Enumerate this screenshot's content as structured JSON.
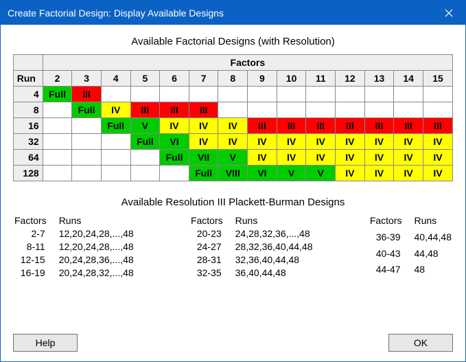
{
  "window": {
    "title": "Create Factorial Design: Display Available Designs"
  },
  "captions": {
    "designs": "Available Factorial Designs (with Resolution)",
    "plackett": "Available Resolution III Plackett-Burman Designs"
  },
  "table": {
    "factorsHeader": "Factors",
    "runHeader": "Run",
    "factorCols": [
      "2",
      "3",
      "4",
      "5",
      "6",
      "7",
      "8",
      "9",
      "10",
      "11",
      "12",
      "13",
      "14",
      "15"
    ],
    "rows": [
      {
        "run": "4",
        "cells": [
          {
            "v": "Full",
            "c": "green"
          },
          {
            "v": "III",
            "c": "red"
          },
          null,
          null,
          null,
          null,
          null,
          null,
          null,
          null,
          null,
          null,
          null,
          null
        ]
      },
      {
        "run": "8",
        "cells": [
          null,
          {
            "v": "Full",
            "c": "green"
          },
          {
            "v": "IV",
            "c": "yellow"
          },
          {
            "v": "III",
            "c": "red"
          },
          {
            "v": "III",
            "c": "red"
          },
          {
            "v": "III",
            "c": "red"
          },
          null,
          null,
          null,
          null,
          null,
          null,
          null,
          null
        ]
      },
      {
        "run": "16",
        "cells": [
          null,
          null,
          {
            "v": "Full",
            "c": "green"
          },
          {
            "v": "V",
            "c": "green"
          },
          {
            "v": "IV",
            "c": "yellow"
          },
          {
            "v": "IV",
            "c": "yellow"
          },
          {
            "v": "IV",
            "c": "yellow"
          },
          {
            "v": "III",
            "c": "red"
          },
          {
            "v": "III",
            "c": "red"
          },
          {
            "v": "III",
            "c": "red"
          },
          {
            "v": "III",
            "c": "red"
          },
          {
            "v": "III",
            "c": "red"
          },
          {
            "v": "III",
            "c": "red"
          },
          {
            "v": "III",
            "c": "red"
          }
        ]
      },
      {
        "run": "32",
        "cells": [
          null,
          null,
          null,
          {
            "v": "Full",
            "c": "green"
          },
          {
            "v": "VI",
            "c": "green"
          },
          {
            "v": "IV",
            "c": "yellow"
          },
          {
            "v": "IV",
            "c": "yellow"
          },
          {
            "v": "IV",
            "c": "yellow"
          },
          {
            "v": "IV",
            "c": "yellow"
          },
          {
            "v": "IV",
            "c": "yellow"
          },
          {
            "v": "IV",
            "c": "yellow"
          },
          {
            "v": "IV",
            "c": "yellow"
          },
          {
            "v": "IV",
            "c": "yellow"
          },
          {
            "v": "IV",
            "c": "yellow"
          }
        ]
      },
      {
        "run": "64",
        "cells": [
          null,
          null,
          null,
          null,
          {
            "v": "Full",
            "c": "green"
          },
          {
            "v": "VII",
            "c": "green"
          },
          {
            "v": "V",
            "c": "green"
          },
          {
            "v": "IV",
            "c": "yellow"
          },
          {
            "v": "IV",
            "c": "yellow"
          },
          {
            "v": "IV",
            "c": "yellow"
          },
          {
            "v": "IV",
            "c": "yellow"
          },
          {
            "v": "IV",
            "c": "yellow"
          },
          {
            "v": "IV",
            "c": "yellow"
          },
          {
            "v": "IV",
            "c": "yellow"
          }
        ]
      },
      {
        "run": "128",
        "cells": [
          null,
          null,
          null,
          null,
          null,
          {
            "v": "Full",
            "c": "green"
          },
          {
            "v": "VIII",
            "c": "green"
          },
          {
            "v": "VI",
            "c": "green"
          },
          {
            "v": "V",
            "c": "green"
          },
          {
            "v": "V",
            "c": "green"
          },
          {
            "v": "IV",
            "c": "yellow"
          },
          {
            "v": "IV",
            "c": "yellow"
          },
          {
            "v": "IV",
            "c": "yellow"
          },
          {
            "v": "IV",
            "c": "yellow"
          }
        ]
      }
    ]
  },
  "pb": {
    "headers": {
      "factors": "Factors",
      "runs": "Runs"
    },
    "columns": [
      [
        {
          "f": "2-7",
          "r": "12,20,24,28,...,48"
        },
        {
          "f": "8-11",
          "r": "12,20,24,28,...,48"
        },
        {
          "f": "12-15",
          "r": "20,24,28,36,...,48"
        },
        {
          "f": "16-19",
          "r": "20,24,28,32,...,48"
        }
      ],
      [
        {
          "f": "20-23",
          "r": "24,28,32,36,...,48"
        },
        {
          "f": "24-27",
          "r": "28,32,36,40,44,48"
        },
        {
          "f": "28-31",
          "r": "32,36,40,44,48"
        },
        {
          "f": "32-35",
          "r": "36,40,44,48"
        }
      ],
      [
        {
          "f": "36-39",
          "r": "40,44,48"
        },
        {
          "f": "40-43",
          "r": "44,48"
        },
        {
          "f": "44-47",
          "r": "48"
        }
      ]
    ]
  },
  "buttons": {
    "help": "Help",
    "ok": "OK"
  }
}
